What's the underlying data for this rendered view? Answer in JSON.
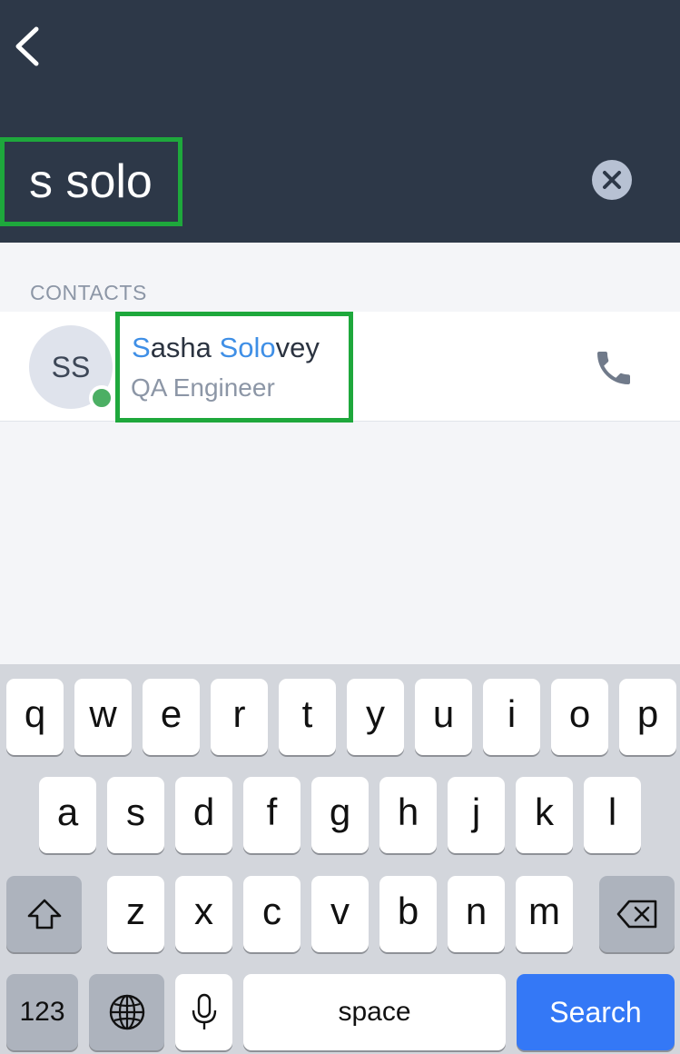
{
  "header": {
    "back_icon": "chevron-left-icon",
    "search_query": "s solo",
    "clear_icon": "close-circle-icon"
  },
  "results": {
    "section_label": "CONTACTS",
    "contacts": [
      {
        "initials": "SS",
        "name_parts": [
          "S",
          "asha ",
          "Solo",
          "vey"
        ],
        "title": "QA Engineer",
        "online": true,
        "call_icon": "phone-icon"
      }
    ]
  },
  "keyboard": {
    "row1": [
      "q",
      "w",
      "e",
      "r",
      "t",
      "y",
      "u",
      "i",
      "o",
      "p"
    ],
    "row2": [
      "a",
      "s",
      "d",
      "f",
      "g",
      "h",
      "j",
      "k",
      "l"
    ],
    "row3": [
      "z",
      "x",
      "c",
      "v",
      "b",
      "n",
      "m"
    ],
    "shift_icon": "shift-icon",
    "backspace_icon": "backspace-icon",
    "numbers_label": "123",
    "globe_icon": "globe-icon",
    "mic_icon": "microphone-icon",
    "space_label": "space",
    "search_label": "Search"
  },
  "colors": {
    "header_bg": "#2d3848",
    "highlight": "#3f8fe6",
    "online": "#4caf64",
    "search_key": "#3478f6",
    "annotation_border": "#1ea83c"
  }
}
